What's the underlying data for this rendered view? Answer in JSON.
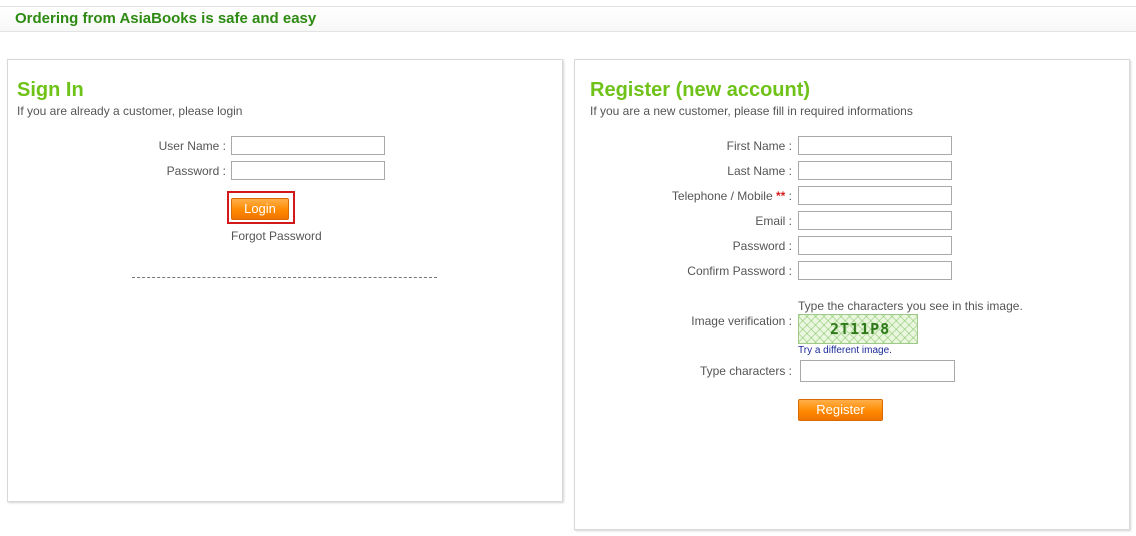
{
  "header": {
    "headline": "Ordering from AsiaBooks is safe and easy"
  },
  "signin": {
    "title": "Sign In",
    "subtitle": "If you are already a customer, please login",
    "fields": {
      "username_label": "User Name :",
      "username_value": "",
      "password_label": "Password :",
      "password_value": ""
    },
    "login_label": "Login",
    "forgot_label": "Forgot Password"
  },
  "register": {
    "title": "Register (new account)",
    "subtitle": "If you are a new customer, please fill in required informations",
    "fields": {
      "first_name_label": "First Name :",
      "first_name_value": "",
      "last_name_label": "Last Name :",
      "last_name_value": "",
      "telephone_label": "Telephone / Mobile",
      "telephone_required_mark": "**",
      "telephone_colon": " :",
      "telephone_value": "",
      "email_label": "Email :",
      "email_value": "",
      "password_label": "Password :",
      "password_value": "",
      "confirm_password_label": "Confirm Password :",
      "confirm_password_value": ""
    },
    "captcha": {
      "label": "Image verification :",
      "instruction": "Type the characters you see in this image.",
      "code": "2T11P8",
      "refresh_link": "Try a different image.",
      "type_label": "Type characters :",
      "type_value": ""
    },
    "register_label": "Register"
  },
  "colors": {
    "headline": "#2d8a12",
    "panel_title": "#6ec218",
    "button": "#ff8a00",
    "highlight_ring": "#d21a1a",
    "link": "#1a2a9a"
  }
}
